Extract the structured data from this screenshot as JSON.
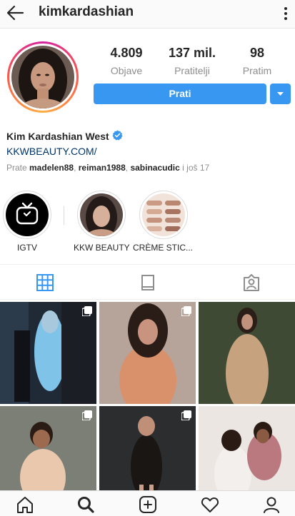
{
  "header": {
    "username": "kimkardashian",
    "back_icon": "arrow-left-icon",
    "more_icon": "more-vertical-icon"
  },
  "profile": {
    "stats": [
      {
        "value": "4.809",
        "label": "Objave"
      },
      {
        "value": "137 mil.",
        "label": "Pratitelji"
      },
      {
        "value": "98",
        "label": "Pratim"
      }
    ],
    "follow_label": "Prati",
    "follow_color": "#3897f0",
    "display_name": "Kim Kardashian West",
    "verified_color": "#3897f0",
    "link": "KKWBEAUTY.COM/",
    "followed_by_prefix": "Prate ",
    "followed_by_users": [
      "madelen88",
      "reiman1988",
      "sabinacudic"
    ],
    "followed_by_suffix": " i još 17"
  },
  "highlights": [
    {
      "label": "IGTV",
      "icon": "igtv-icon"
    },
    {
      "label": "KKW BEAUTY"
    },
    {
      "label": "CRÈME STIC..."
    }
  ],
  "tabs": [
    {
      "icon": "grid-icon",
      "active": true
    },
    {
      "icon": "igtv-tab-icon",
      "active": false
    },
    {
      "icon": "tagged-icon",
      "active": false
    }
  ],
  "bottom_nav": [
    {
      "icon": "home-icon"
    },
    {
      "icon": "search-icon",
      "active": true
    },
    {
      "icon": "new-post-icon"
    },
    {
      "icon": "activity-icon"
    },
    {
      "icon": "profile-icon"
    }
  ]
}
